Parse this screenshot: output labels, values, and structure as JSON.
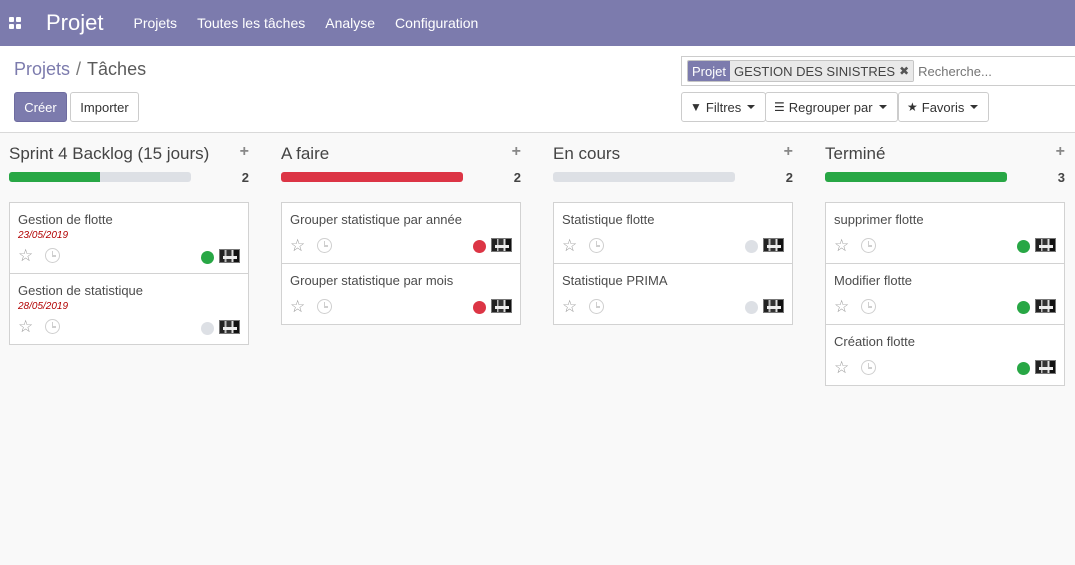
{
  "navbar": {
    "app_title": "Projet",
    "menu": [
      "Projets",
      "Toutes les tâches",
      "Analyse",
      "Configuration"
    ],
    "bg_color": "#7c7bad"
  },
  "breadcrumb": {
    "parent": "Projets",
    "separator": "/",
    "current": "Tâches"
  },
  "buttons": {
    "create": "Créer",
    "import": "Importer"
  },
  "search": {
    "facet_category": "Projet",
    "facet_value": "GESTION DES SINISTRES",
    "facet_remove": "✖",
    "placeholder": "Recherche..."
  },
  "search_buttons": {
    "filters": "Filtres",
    "groupby": "Regrouper par",
    "favorites": "Favoris"
  },
  "columns": [
    {
      "title": "Sprint 4 Backlog (15 jours)",
      "count": "2",
      "plus": "+",
      "progress_color": "#28a745",
      "progress_fraction": 0.5,
      "cards": [
        {
          "name": "Gestion de flotte",
          "date": "23/05/2019",
          "status_color": "#28a745"
        },
        {
          "name": "Gestion de statistique",
          "date": "28/05/2019",
          "status_color": "#dde0e5"
        }
      ]
    },
    {
      "title": "A faire",
      "count": "2",
      "plus": "+",
      "progress_color": "#dc3545",
      "progress_fraction": 1.0,
      "cards": [
        {
          "name": "Grouper statistique par année",
          "date": "",
          "status_color": "#dc3545"
        },
        {
          "name": "Grouper statistique par mois",
          "date": "",
          "status_color": "#dc3545"
        }
      ]
    },
    {
      "title": "En cours",
      "count": "2",
      "plus": "+",
      "progress_color": "#dde0e5",
      "progress_fraction": 0.0,
      "cards": [
        {
          "name": "Statistique flotte",
          "date": "",
          "status_color": "#dde0e5"
        },
        {
          "name": "Statistique PRIMA",
          "date": "",
          "status_color": "#dde0e5"
        }
      ]
    },
    {
      "title": "Terminé",
      "count": "3",
      "plus": "+",
      "progress_color": "#28a745",
      "progress_fraction": 1.0,
      "cards": [
        {
          "name": "supprimer flotte",
          "date": "",
          "status_color": "#28a745"
        },
        {
          "name": "Modifier flotte",
          "date": "",
          "status_color": "#28a745"
        },
        {
          "name": "Création flotte",
          "date": "",
          "status_color": "#28a745"
        }
      ]
    }
  ]
}
